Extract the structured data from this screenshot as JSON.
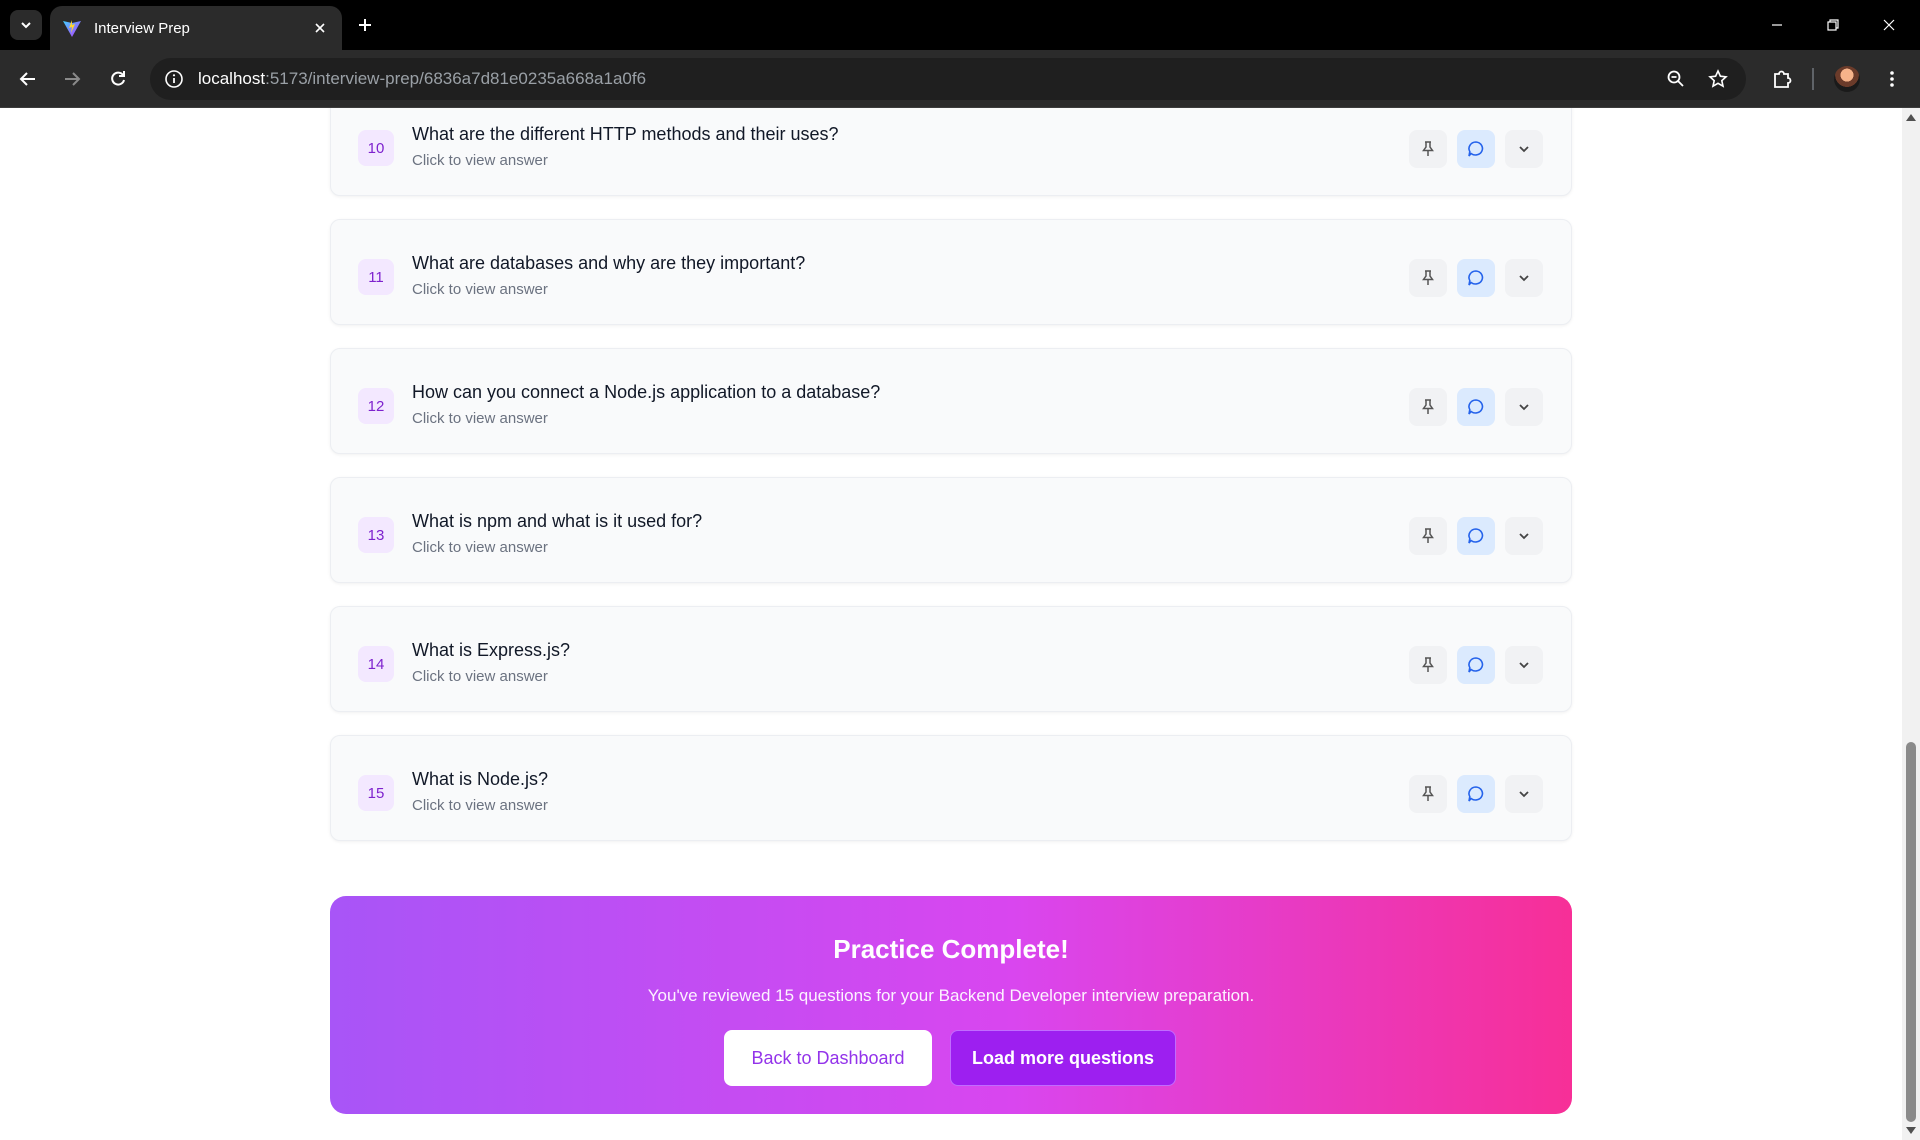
{
  "browser": {
    "tab_title": "Interview Prep",
    "url_host": "localhost",
    "url_path": ":5173/interview-prep/6836a7d81e0235a668a1a0f6"
  },
  "questions": [
    {
      "number": "10",
      "text": "What are the different HTTP methods and their uses?",
      "hint": "Click to view answer"
    },
    {
      "number": "11",
      "text": "What are databases and why are they important?",
      "hint": "Click to view answer"
    },
    {
      "number": "12",
      "text": "How can you connect a Node.js application to a database?",
      "hint": "Click to view answer"
    },
    {
      "number": "13",
      "text": "What is npm and what is it used for?",
      "hint": "Click to view answer"
    },
    {
      "number": "14",
      "text": "What is Express.js?",
      "hint": "Click to view answer"
    },
    {
      "number": "15",
      "text": "What is Node.js?",
      "hint": "Click to view answer"
    }
  ],
  "completion": {
    "title": "Practice Complete!",
    "subtitle": "You've reviewed 15 questions for your Backend Developer interview preparation.",
    "back_button": "Back to Dashboard",
    "load_more_button": "Load more questions"
  },
  "icons": {
    "pin": "pin-icon",
    "chat": "chat-bubble-icon",
    "expand": "chevron-down-icon"
  },
  "colors": {
    "accent_purple": "#9333ea",
    "question_number_bg": "#f3e8ff",
    "chat_button_bg": "#dbeafe",
    "banner_gradient_start": "#a855f7",
    "banner_gradient_end": "#f72f97"
  }
}
